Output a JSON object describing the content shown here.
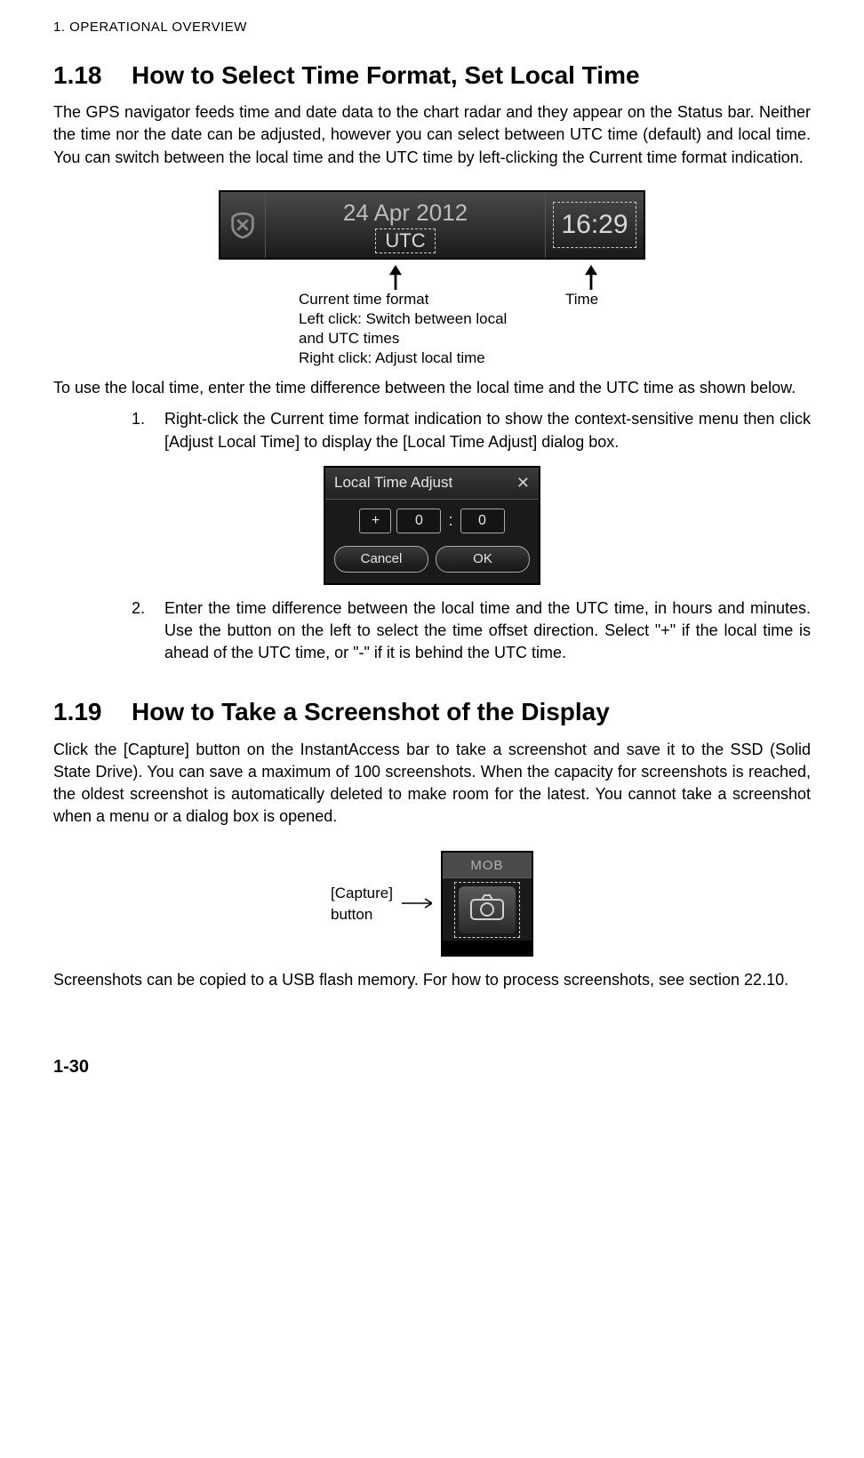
{
  "chapterHeader": "1.  OPERATIONAL OVERVIEW",
  "s118": {
    "num": "1.18",
    "title": "How to Select Time Format, Set Local Time",
    "intro": "The GPS navigator feeds time and date data to the chart radar and they appear on the Status bar. Neither the time nor the date can be adjusted, however you can select between UTC time (default) and local time. You can switch between the local time and the UTC time by left-clicking the Current time format indication.",
    "fig": {
      "date": "24 Apr 2012",
      "tz": "UTC",
      "time": "16:29",
      "capLeftL1": "Current time format",
      "capLeftL2": "Left click: Switch between local",
      "capLeftL3": "and UTC times",
      "capLeftL4": "Right click: Adjust local time",
      "capRight": "Time"
    },
    "para2": "To use the local time, enter the time difference between the local time and the UTC time as shown below.",
    "step1num": "1.",
    "step1": "Right-click the Current time format indication to show the context-sensitive menu then click [Adjust Local Time] to display the [Local Time Adjust] dialog box.",
    "dlg": {
      "title": "Local Time Adjust",
      "sign": "+",
      "hours": "0",
      "mins": "0",
      "cancel": "Cancel",
      "ok": "OK"
    },
    "step2num": "2.",
    "step2": "Enter the time difference between the local time and the UTC time, in hours and minutes. Use the button on the left to select the time offset direction. Select \"+\" if the local time is ahead of the UTC time, or \"-\" if it is behind the UTC time."
  },
  "s119": {
    "num": "1.19",
    "title": "How to Take a Screenshot of the Display",
    "intro": "Click the [Capture] button on the InstantAccess bar to take a screenshot and save it to the SSD (Solid State Drive). You can save a maximum of 100 screenshots. When the capacity for screenshots is reached, the oldest screenshot is automatically deleted to make room for the latest. You cannot take a screenshot when a menu or a dialog box is opened.",
    "fig": {
      "label": "[Capture]\nbutton",
      "mob": "MOB"
    },
    "outro": "Screenshots can be copied to a USB flash memory. For how to process screenshots, see section 22.10."
  },
  "pageNum": "1-30"
}
